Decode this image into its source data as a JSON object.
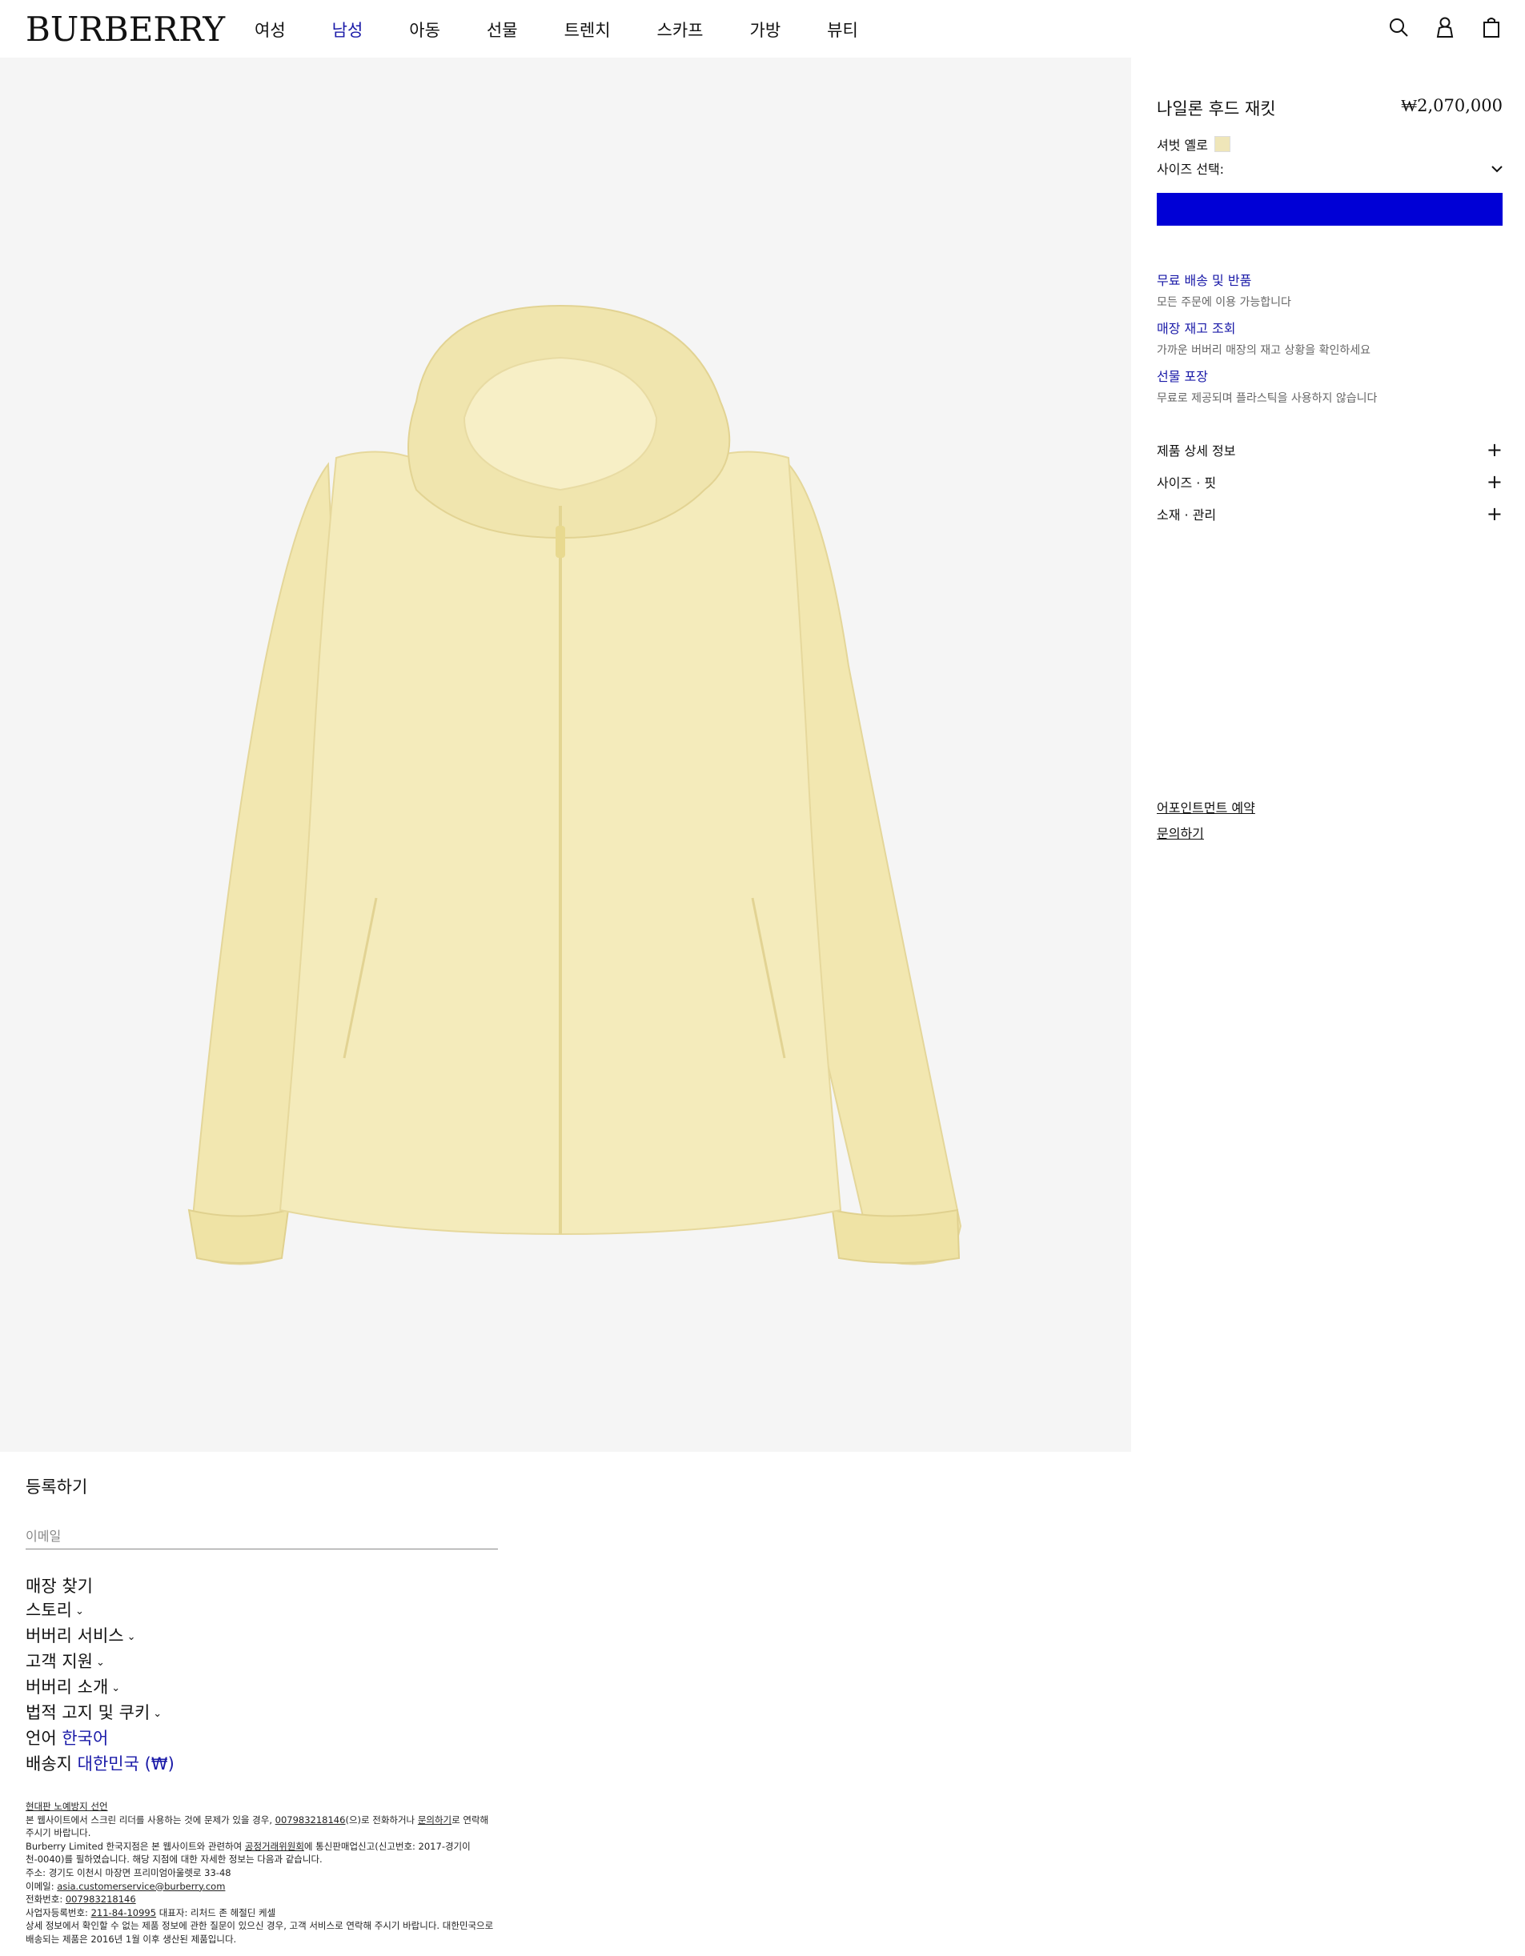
{
  "header": {
    "logo": "BURBERRY",
    "nav": [
      "여성",
      "남성",
      "아동",
      "선물",
      "트렌치",
      "스카프",
      "가방",
      "뷰티"
    ],
    "active_nav": "남성"
  },
  "product": {
    "title": "나일론 후드 재킷",
    "price": "₩2,070,000",
    "color_name": "셔벗 옐로",
    "swatch_color": "#efe6b9",
    "size_label": "사이즈 선택:",
    "cta_label": ""
  },
  "services": [
    {
      "title": "무료 배송 및 반품",
      "desc": "모든 주문에 이용 가능합니다"
    },
    {
      "title": "매장 재고 조회",
      "desc": "가까운 버버리 매장의 재고 상황을 확인하세요"
    },
    {
      "title": "선물 포장",
      "desc": "무료로 제공되며 플라스틱을 사용하지 않습니다"
    }
  ],
  "accordions": [
    "제품 상세 정보",
    "사이즈 · 핏",
    "소재 · 관리"
  ],
  "panel_links": [
    "어포인트먼트 예약",
    "문의하기"
  ],
  "footer": {
    "register": "등록하기",
    "email_placeholder": "이메일",
    "store_finder": "매장 찾기",
    "sections": [
      "스토리",
      "버버리 서비스",
      "고객 지원",
      "버버리 소개",
      "법적 고지 및 쿠키"
    ],
    "language_label": "언어",
    "language_value": "한국어",
    "ship_label": "배송지",
    "ship_value": "대한민국 (₩)",
    "legal": {
      "l1": "현대판 노예방지 선언",
      "l2a": "본 웹사이트에서 스크린 리더를 사용하는 것에 문제가 있을 경우,",
      "l2b": "007983218146",
      "l2c": "(으)로 전화하거나",
      "l2d": "문의하기",
      "l2e": "로 연락해 주시기 바랍니다.",
      "l3a": "Burberry Limited 한국지점은 본 웹사이트와 관련하여",
      "l3b": "공정거래위원회",
      "l3c": "에 통신판매업신고(신고번호: 2017-경기이천-0040)를 필하였습니다. 해당 지점에 대한 자세한 정보는 다음과 같습니다.",
      "l4": "주소: 경기도 이천시 마장면 프리미엄아울렛로 33-48",
      "l5a": "이메일:",
      "l5b": "asia.customerservice@burberry.com",
      "l6a": "전화번호:",
      "l6b": "007983218146",
      "l7a": "사업자등록번호:",
      "l7b": "211-84-10995",
      "l7c": "대표자: 리처드 존 헤절딘 케셀",
      "l8": "상세 정보에서 확인할 수 없는 제품 정보에 관한 질문이 있으신 경우, 고객 서비스로 연락해 주시기 바랍니다. 대한민국으로 배송되는 제품은 2016년 1월 이후 생산된 제품입니다."
    }
  }
}
